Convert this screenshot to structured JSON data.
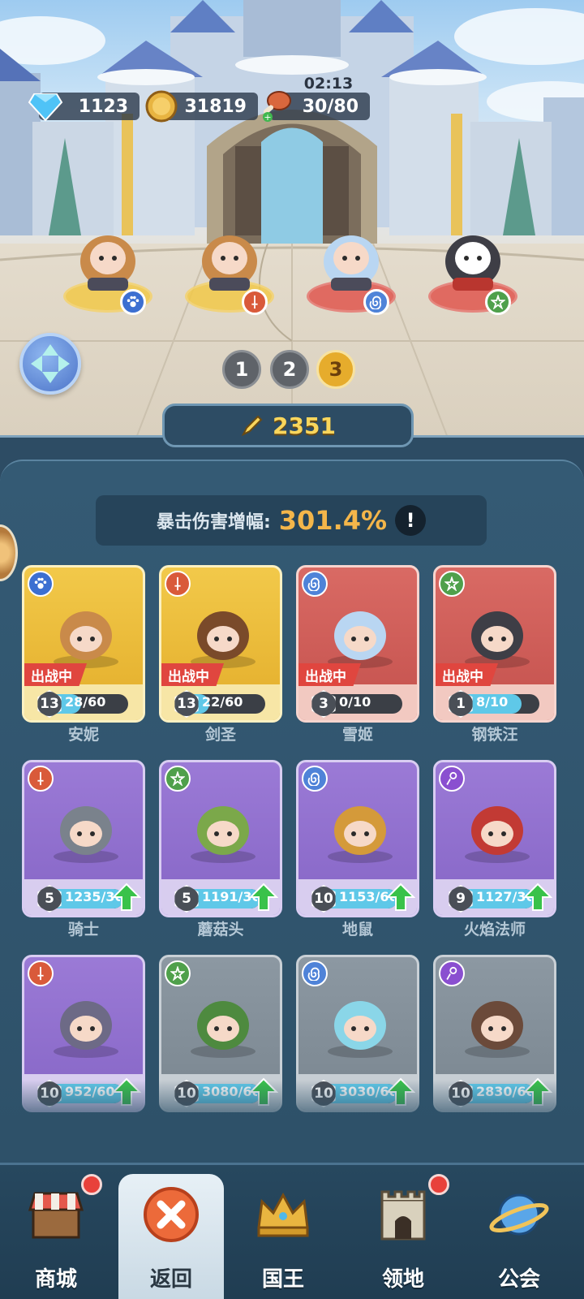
{
  "resources": {
    "gems": "1123",
    "gold": "31819",
    "stamina": "30/80",
    "stamina_timer": "02:13"
  },
  "team_pages": [
    "1",
    "2",
    "3"
  ],
  "active_team_page": "3",
  "team_power": "2351",
  "crit": {
    "label": "暴击伤害增幅:",
    "value": "301.4%",
    "info": "!"
  },
  "colors": {
    "gold_card": "#e3ad2a",
    "red_card": "#c4514d",
    "purple_card": "#8666c6",
    "grey_card": "#7a8690",
    "deploy_tag": "#e0463f",
    "power_text": "#f9d65c",
    "crit_value": "#f4b64a"
  },
  "heroes": [
    {
      "name": "安妮",
      "level": "13",
      "progress": "28/60",
      "fill": 0.47,
      "tag": "出战中",
      "rarity": "gold",
      "type_icon": "paw-icon",
      "type_color": "#3c6fd1",
      "upgrade": false
    },
    {
      "name": "剑圣",
      "level": "13",
      "progress": "22/60",
      "fill": 0.37,
      "tag": "出战中",
      "rarity": "gold",
      "type_icon": "sword-icon",
      "type_color": "#d95a3a",
      "upgrade": false
    },
    {
      "name": "雪姬",
      "level": "3",
      "progress": "0/10",
      "fill": 0.0,
      "tag": "出战中",
      "rarity": "red",
      "type_icon": "swirl-icon",
      "type_color": "#4f83d8",
      "upgrade": false
    },
    {
      "name": "钢铁汪",
      "level": "1",
      "progress": "8/10",
      "fill": 0.8,
      "tag": "出战中",
      "rarity": "red",
      "type_icon": "star-icon",
      "type_color": "#4fa04b",
      "upgrade": false
    },
    {
      "name": "骑士",
      "level": "5",
      "progress": "1235/30",
      "fill": 1.0,
      "tag": "",
      "rarity": "purple",
      "type_icon": "sword-icon",
      "type_color": "#d95a3a",
      "upgrade": true
    },
    {
      "name": "蘑菇头",
      "level": "5",
      "progress": "1191/30",
      "fill": 1.0,
      "tag": "",
      "rarity": "purple",
      "type_icon": "star-icon",
      "type_color": "#4fa04b",
      "upgrade": true
    },
    {
      "name": "地鼠",
      "level": "10",
      "progress": "1153/60",
      "fill": 1.0,
      "tag": "",
      "rarity": "purple",
      "type_icon": "swirl-icon",
      "type_color": "#4f83d8",
      "upgrade": true
    },
    {
      "name": "火焰法师",
      "level": "9",
      "progress": "1127/30",
      "fill": 1.0,
      "tag": "",
      "rarity": "purple",
      "type_icon": "magic-icon",
      "type_color": "#8a4fd0",
      "upgrade": true
    },
    {
      "name": "",
      "level": "10",
      "progress": "952/60",
      "fill": 1.0,
      "tag": "",
      "rarity": "purple",
      "type_icon": "sword-icon",
      "type_color": "#d95a3a",
      "upgrade": true
    },
    {
      "name": "",
      "level": "10",
      "progress": "3080/60",
      "fill": 1.0,
      "tag": "",
      "rarity": "grey",
      "type_icon": "star-icon",
      "type_color": "#4fa04b",
      "upgrade": true
    },
    {
      "name": "",
      "level": "10",
      "progress": "3030/60",
      "fill": 1.0,
      "tag": "",
      "rarity": "grey",
      "type_icon": "swirl-icon",
      "type_color": "#4f83d8",
      "upgrade": true
    },
    {
      "name": "",
      "level": "10",
      "progress": "2830/60",
      "fill": 1.0,
      "tag": "",
      "rarity": "grey",
      "type_icon": "magic-icon",
      "type_color": "#8a4fd0",
      "upgrade": true
    }
  ],
  "team_heroes": [
    {
      "name": "安妮",
      "badge_icon": "paw-icon",
      "badge_color": "#3c6fd1",
      "base_color": "#f2c94a"
    },
    {
      "name": "剑圣",
      "badge_icon": "sword-icon",
      "badge_color": "#d95a3a",
      "base_color": "#f2c94a"
    },
    {
      "name": "雪姬",
      "badge_icon": "swirl-icon",
      "badge_color": "#4f83d8",
      "base_color": "#e0574f"
    },
    {
      "name": "钢铁汪",
      "badge_icon": "star-icon",
      "badge_color": "#4fa04b",
      "base_color": "#e0574f"
    }
  ],
  "nav": [
    {
      "label": "商城",
      "icon": "shop-icon",
      "notify": true,
      "active": false
    },
    {
      "label": "返回",
      "icon": "close-icon",
      "notify": false,
      "active": true
    },
    {
      "label": "国王",
      "icon": "crown-icon",
      "notify": false,
      "active": false
    },
    {
      "label": "领地",
      "icon": "castle-icon",
      "notify": true,
      "active": false
    },
    {
      "label": "公会",
      "icon": "planet-icon",
      "notify": false,
      "active": false
    }
  ]
}
